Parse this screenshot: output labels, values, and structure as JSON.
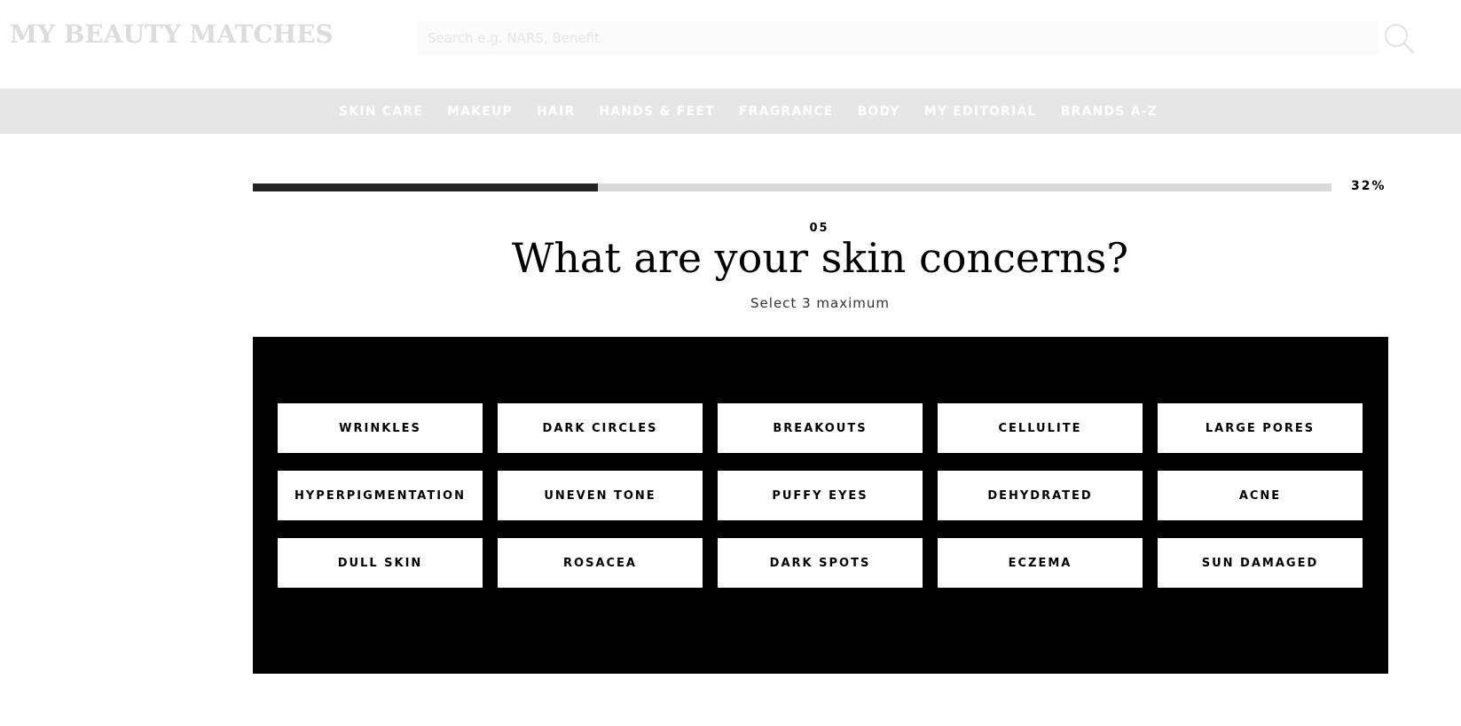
{
  "header": {
    "logo_text": "MY BEAUTY MATCHES",
    "search": {
      "placeholder": "Search e.g. NARS, Benefit",
      "value": ""
    },
    "search_icon": "search-icon"
  },
  "nav": {
    "items": [
      {
        "label": "SKIN CARE"
      },
      {
        "label": "MAKEUP"
      },
      {
        "label": "HAIR"
      },
      {
        "label": "HANDS & FEET"
      },
      {
        "label": "FRAGRANCE"
      },
      {
        "label": "BODY"
      },
      {
        "label": "MY EDITORIAL"
      },
      {
        "label": "BRANDS A-Z"
      }
    ]
  },
  "progress": {
    "fraction": 0.32,
    "label": "32%"
  },
  "question": {
    "number": "05",
    "title": "What are your skin concerns?",
    "subtitle": "Select 3 maximum"
  },
  "options": [
    {
      "label": "WRINKLES"
    },
    {
      "label": "DARK CIRCLES"
    },
    {
      "label": "BREAKOUTS"
    },
    {
      "label": "CELLULITE"
    },
    {
      "label": "LARGE PORES"
    },
    {
      "label": "HYPERPIGMENTATION"
    },
    {
      "label": "UNEVEN TONE"
    },
    {
      "label": "PUFFY EYES"
    },
    {
      "label": "DEHYDRATED"
    },
    {
      "label": "ACNE"
    },
    {
      "label": "DULL SKIN"
    },
    {
      "label": "ROSACEA"
    },
    {
      "label": "DARK SPOTS"
    },
    {
      "label": "ECZEMA"
    },
    {
      "label": "SUN DAMAGED"
    }
  ],
  "colors": {
    "nav_background": "#e6e6e6",
    "progress_fill": "#222222",
    "progress_track": "#d9d9d9",
    "panel_background": "#000000",
    "logo_color": "#dcdcdc"
  }
}
